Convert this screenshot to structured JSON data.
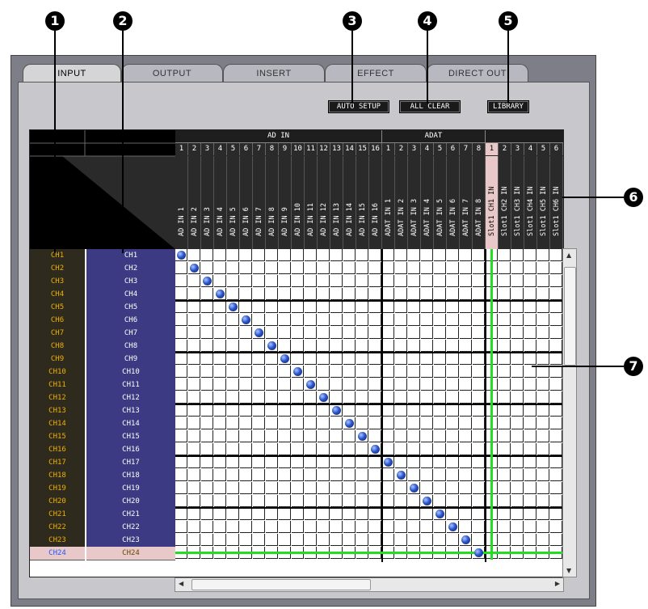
{
  "callouts": [
    "1",
    "2",
    "3",
    "4",
    "5",
    "6",
    "7"
  ],
  "tabs": [
    "INPUT",
    "OUTPUT",
    "INSERT",
    "EFFECT",
    "DIRECT OUT"
  ],
  "buttons": {
    "auto_setup": "AUTO SETUP",
    "all_clear": "ALL CLEAR",
    "library": "LIBRARY"
  },
  "groups": {
    "ad_in": "AD IN",
    "adat": "ADAT"
  },
  "column_numbers": [
    "1",
    "2",
    "3",
    "4",
    "5",
    "6",
    "7",
    "8",
    "9",
    "10",
    "11",
    "12",
    "13",
    "14",
    "15",
    "16",
    "1",
    "2",
    "3",
    "4",
    "5",
    "6",
    "7",
    "8",
    "1",
    "2",
    "3",
    "4",
    "5",
    "6"
  ],
  "column_labels": [
    "AD IN 1",
    "AD IN 2",
    "AD IN 3",
    "AD IN 4",
    "AD IN 5",
    "AD IN 6",
    "AD IN 7",
    "AD IN 8",
    "AD IN 9",
    "AD IN 10",
    "AD IN 11",
    "AD IN 12",
    "AD IN 13",
    "AD IN 14",
    "AD IN 15",
    "AD IN 16",
    "ADAT IN 1",
    "ADAT IN 2",
    "ADAT IN 3",
    "ADAT IN 4",
    "ADAT IN 5",
    "ADAT IN 6",
    "ADAT IN 7",
    "ADAT IN 8",
    "Slot1 CH1 IN",
    "Slot1 CH2 IN",
    "Slot1 CH3 IN",
    "Slot1 CH4 IN",
    "Slot1 CH5 IN",
    "Slot1 CH6 IN"
  ],
  "rows_left": [
    "CH1",
    "CH2",
    "CH3",
    "CH4",
    "CH5",
    "CH6",
    "CH7",
    "CH8",
    "CH9",
    "CH10",
    "CH11",
    "CH12",
    "CH13",
    "CH14",
    "CH15",
    "CH16",
    "CH17",
    "CH18",
    "CH19",
    "CH20",
    "CH21",
    "CH22",
    "CH23",
    "CH24"
  ],
  "rows_right": [
    "CH1",
    "CH2",
    "CH3",
    "CH4",
    "CH5",
    "CH6",
    "CH7",
    "CH8",
    "CH9",
    "CH10",
    "CH11",
    "CH12",
    "CH13",
    "CH14",
    "CH15",
    "CH16",
    "CH17",
    "CH18",
    "CH19",
    "CH20",
    "CH21",
    "CH22",
    "CH23",
    "CH24"
  ],
  "selected_row": 23,
  "selected_column": 24,
  "patches": [
    [
      0,
      0
    ],
    [
      1,
      1
    ],
    [
      2,
      2
    ],
    [
      3,
      3
    ],
    [
      4,
      4
    ],
    [
      5,
      5
    ],
    [
      6,
      6
    ],
    [
      7,
      7
    ],
    [
      8,
      8
    ],
    [
      9,
      9
    ],
    [
      10,
      10
    ],
    [
      11,
      11
    ],
    [
      12,
      12
    ],
    [
      13,
      13
    ],
    [
      14,
      14
    ],
    [
      15,
      15
    ],
    [
      16,
      16
    ],
    [
      17,
      17
    ],
    [
      18,
      18
    ],
    [
      19,
      19
    ],
    [
      20,
      20
    ],
    [
      21,
      21
    ],
    [
      22,
      22
    ],
    [
      23,
      23
    ]
  ],
  "colors": {
    "accent_green": "#22dd22",
    "row_label_orange": "#f0b000",
    "row_label_blue": "#3b3a82",
    "patch_blue": "#2b55c8"
  }
}
